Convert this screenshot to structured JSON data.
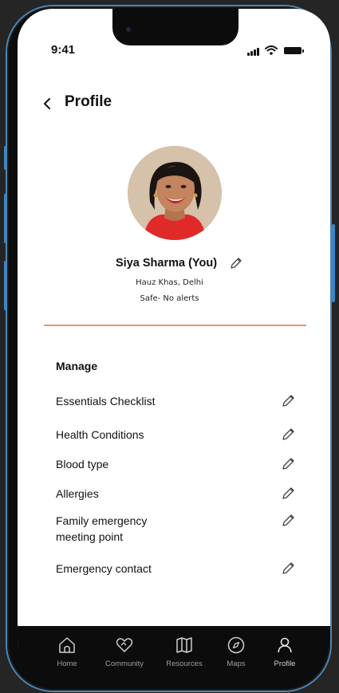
{
  "status_bar": {
    "time": "9:41"
  },
  "header": {
    "title": "Profile"
  },
  "profile": {
    "name": "Siya Sharma (You)",
    "location": "Hauz Khas, Delhi",
    "status": "Safe- No alerts"
  },
  "manage": {
    "title": "Manage",
    "items": [
      {
        "label": "Essentials Checklist"
      },
      {
        "label": "Health Conditions"
      },
      {
        "label": "Blood type"
      },
      {
        "label": "Allergies"
      },
      {
        "label": "Family emergency meeting point"
      },
      {
        "label": "Emergency contact"
      }
    ]
  },
  "tabs": [
    {
      "label": "Home",
      "icon": "home-icon"
    },
    {
      "label": "Community",
      "icon": "heart-hands-icon"
    },
    {
      "label": "Resources",
      "icon": "map-book-icon"
    },
    {
      "label": "Maps",
      "icon": "compass-icon"
    },
    {
      "label": "Profile",
      "icon": "person-icon"
    }
  ],
  "colors": {
    "accent": "#ef8d73",
    "tabbar": "#0c0c0c",
    "tab_label": "#9e9e9e"
  }
}
